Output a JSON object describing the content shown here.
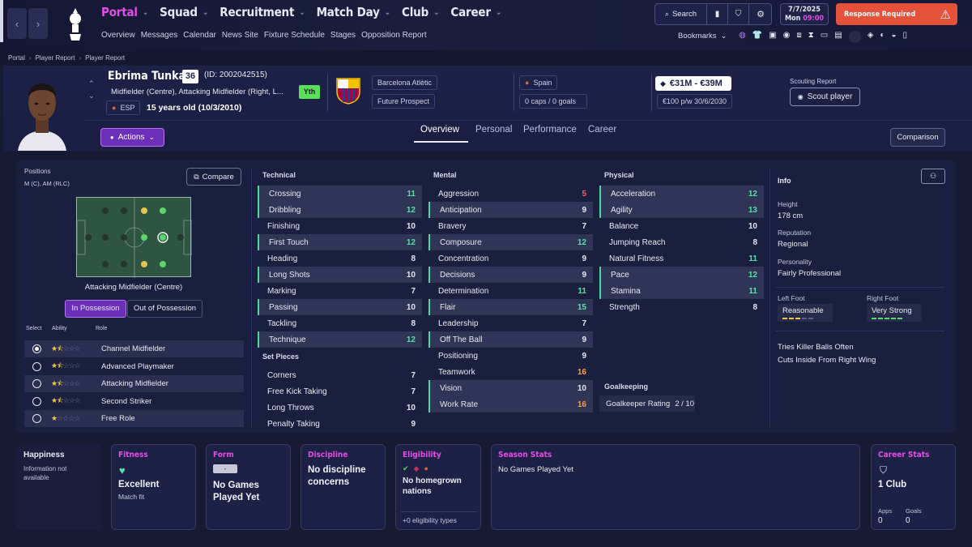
{
  "topbar": {
    "menu": [
      {
        "label": "Portal",
        "active": true
      },
      {
        "label": "Squad"
      },
      {
        "label": "Recruitment"
      },
      {
        "label": "Match Day"
      },
      {
        "label": "Club"
      },
      {
        "label": "Career"
      }
    ],
    "submenu": [
      "Overview",
      "Messages",
      "Calendar",
      "News Site",
      "Fixture Schedule",
      "Stages",
      "Opposition Report"
    ],
    "search_label": "Search",
    "date": "7/7/2025",
    "day_time": "Mon",
    "time": "09:00",
    "response_label": "Response Required",
    "bookmarks_label": "Bookmarks"
  },
  "breadcrumb": [
    "Portal",
    "Player Report",
    "Player Report"
  ],
  "player": {
    "name": "Ebrima Tunkara",
    "number": "36",
    "id": "(ID: 2002042515)",
    "positions": "Midfielder (Centre), Attacking Midfielder (Right, L...",
    "youth_badge": "Yth",
    "nationality_code": "ESP",
    "age": "15 years old (10/3/2010)",
    "club": "Barcelona Atlètic",
    "status": "Future Prospect",
    "nation": "Spain",
    "caps": "0 caps / 0 goals",
    "value": "€31M - €39M",
    "contract": "€100 p/w 30/6/2030",
    "scouting_label": "Scouting Report",
    "scout_button": "Scout player",
    "actions_label": "Actions",
    "comparison_label": "Comparison"
  },
  "tabs": [
    "Overview",
    "Personal",
    "Performance",
    "Career"
  ],
  "positions_panel": {
    "title": "Positions",
    "pos_text": "M (C), AM (RLC)",
    "compare_label": "Compare",
    "role_caption": "Attacking Midfielder (Centre)",
    "in_possession": "In Possession",
    "out_possession": "Out of Possession",
    "col_select": "Select",
    "col_ability": "Ability",
    "col_role": "Role",
    "roles": [
      {
        "name": "Channel Midfielder",
        "stars": 1.5,
        "selected": true
      },
      {
        "name": "Advanced Playmaker",
        "stars": 1.5,
        "selected": false
      },
      {
        "name": "Attacking Midfielder",
        "stars": 1.5,
        "selected": false
      },
      {
        "name": "Second Striker",
        "stars": 1.5,
        "selected": false
      },
      {
        "name": "Free Role",
        "stars": 1,
        "selected": false
      }
    ]
  },
  "technical": {
    "title": "Technical",
    "attrs": [
      {
        "name": "Crossing",
        "value": "11",
        "hl": true
      },
      {
        "name": "Dribbling",
        "value": "12",
        "hl": true
      },
      {
        "name": "Finishing",
        "value": "10"
      },
      {
        "name": "First Touch",
        "value": "12",
        "hl": true
      },
      {
        "name": "Heading",
        "value": "8"
      },
      {
        "name": "Long Shots",
        "value": "10",
        "hl": true
      },
      {
        "name": "Marking",
        "value": "7"
      },
      {
        "name": "Passing",
        "value": "10",
        "hl": true
      },
      {
        "name": "Tackling",
        "value": "8"
      },
      {
        "name": "Technique",
        "value": "12",
        "hl": true
      }
    ]
  },
  "set_pieces": {
    "title": "Set Pieces",
    "attrs": [
      {
        "name": "Corners",
        "value": "7"
      },
      {
        "name": "Free Kick Taking",
        "value": "7"
      },
      {
        "name": "Long Throws",
        "value": "10"
      },
      {
        "name": "Penalty Taking",
        "value": "9"
      }
    ]
  },
  "mental": {
    "title": "Mental",
    "attrs": [
      {
        "name": "Aggression",
        "value": "5"
      },
      {
        "name": "Anticipation",
        "value": "9",
        "hl": true
      },
      {
        "name": "Bravery",
        "value": "7"
      },
      {
        "name": "Composure",
        "value": "12",
        "hl": true
      },
      {
        "name": "Concentration",
        "value": "9"
      },
      {
        "name": "Decisions",
        "value": "9",
        "hl": true
      },
      {
        "name": "Determination",
        "value": "11"
      },
      {
        "name": "Flair",
        "value": "15",
        "hl": true
      },
      {
        "name": "Leadership",
        "value": "7"
      },
      {
        "name": "Off The Ball",
        "value": "9",
        "hl": true
      },
      {
        "name": "Positioning",
        "value": "9"
      },
      {
        "name": "Teamwork",
        "value": "16"
      },
      {
        "name": "Vision",
        "value": "10",
        "hl": true
      },
      {
        "name": "Work Rate",
        "value": "16",
        "hl": true
      }
    ]
  },
  "physical": {
    "title": "Physical",
    "attrs": [
      {
        "name": "Acceleration",
        "value": "12",
        "hl": true
      },
      {
        "name": "Agility",
        "value": "13",
        "hl": true
      },
      {
        "name": "Balance",
        "value": "10"
      },
      {
        "name": "Jumping Reach",
        "value": "8"
      },
      {
        "name": "Natural Fitness",
        "value": "11"
      },
      {
        "name": "Pace",
        "value": "12",
        "hl": true
      },
      {
        "name": "Stamina",
        "value": "11",
        "hl": true
      },
      {
        "name": "Strength",
        "value": "8"
      }
    ]
  },
  "goalkeeping": {
    "title": "Goalkeeping",
    "label": "Goalkeeper Rating",
    "value": "2 / 10"
  },
  "info": {
    "title": "Info",
    "height_label": "Height",
    "height": "178 cm",
    "reputation_label": "Reputation",
    "reputation": "Regional",
    "personality_label": "Personality",
    "personality": "Fairly Professional",
    "left_foot_label": "Left Foot",
    "left_foot": "Reasonable",
    "right_foot_label": "Right Foot",
    "right_foot": "Very Strong",
    "traits": [
      "Tries Killer Balls Often",
      "Cuts Inside From Right Wing"
    ]
  },
  "cards": {
    "happiness_title": "Happiness",
    "happiness_text": "Information not available",
    "fitness_title": "Fitness",
    "fitness_value": "Excellent",
    "fitness_sub": "Match fit",
    "form_title": "Form",
    "form_badge": "-",
    "form_value": "No Games Played Yet",
    "discipline_title": "Discipline",
    "discipline_value": "No discipline concerns",
    "eligibility_title": "Eligibility",
    "eligibility_value": "No homegrown nations",
    "eligibility_sub": "+0 eligibility types",
    "season_title": "Season Stats",
    "season_value": "No Games Played Yet",
    "career_title": "Career Stats",
    "career_value": "1 Club",
    "apps_label": "Apps",
    "apps": "0",
    "goals_label": "Goals",
    "goals": "0"
  },
  "colors": {
    "accent": "#e34ee6",
    "good": "#57e0a5",
    "high": "#ff9f3a",
    "low": "#ff5b5b",
    "warn": "#e4523a"
  }
}
